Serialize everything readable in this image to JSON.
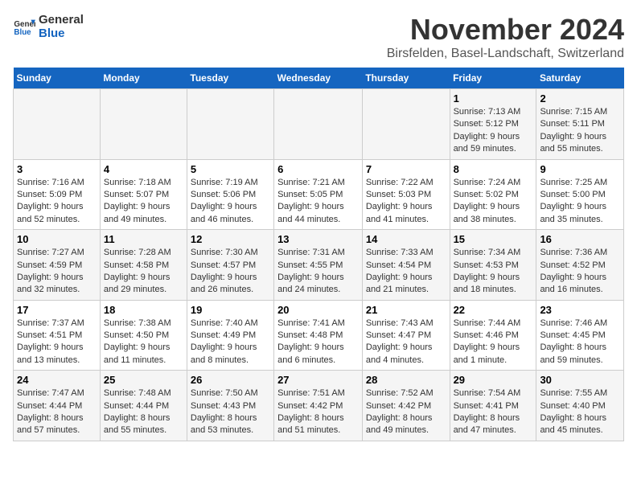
{
  "logo": {
    "line1": "General",
    "line2": "Blue"
  },
  "title": "November 2024",
  "location": "Birsfelden, Basel-Landschaft, Switzerland",
  "days_of_week": [
    "Sunday",
    "Monday",
    "Tuesday",
    "Wednesday",
    "Thursday",
    "Friday",
    "Saturday"
  ],
  "weeks": [
    [
      {
        "day": "",
        "info": ""
      },
      {
        "day": "",
        "info": ""
      },
      {
        "day": "",
        "info": ""
      },
      {
        "day": "",
        "info": ""
      },
      {
        "day": "",
        "info": ""
      },
      {
        "day": "1",
        "info": "Sunrise: 7:13 AM\nSunset: 5:12 PM\nDaylight: 9 hours and 59 minutes."
      },
      {
        "day": "2",
        "info": "Sunrise: 7:15 AM\nSunset: 5:11 PM\nDaylight: 9 hours and 55 minutes."
      }
    ],
    [
      {
        "day": "3",
        "info": "Sunrise: 7:16 AM\nSunset: 5:09 PM\nDaylight: 9 hours and 52 minutes."
      },
      {
        "day": "4",
        "info": "Sunrise: 7:18 AM\nSunset: 5:07 PM\nDaylight: 9 hours and 49 minutes."
      },
      {
        "day": "5",
        "info": "Sunrise: 7:19 AM\nSunset: 5:06 PM\nDaylight: 9 hours and 46 minutes."
      },
      {
        "day": "6",
        "info": "Sunrise: 7:21 AM\nSunset: 5:05 PM\nDaylight: 9 hours and 44 minutes."
      },
      {
        "day": "7",
        "info": "Sunrise: 7:22 AM\nSunset: 5:03 PM\nDaylight: 9 hours and 41 minutes."
      },
      {
        "day": "8",
        "info": "Sunrise: 7:24 AM\nSunset: 5:02 PM\nDaylight: 9 hours and 38 minutes."
      },
      {
        "day": "9",
        "info": "Sunrise: 7:25 AM\nSunset: 5:00 PM\nDaylight: 9 hours and 35 minutes."
      }
    ],
    [
      {
        "day": "10",
        "info": "Sunrise: 7:27 AM\nSunset: 4:59 PM\nDaylight: 9 hours and 32 minutes."
      },
      {
        "day": "11",
        "info": "Sunrise: 7:28 AM\nSunset: 4:58 PM\nDaylight: 9 hours and 29 minutes."
      },
      {
        "day": "12",
        "info": "Sunrise: 7:30 AM\nSunset: 4:57 PM\nDaylight: 9 hours and 26 minutes."
      },
      {
        "day": "13",
        "info": "Sunrise: 7:31 AM\nSunset: 4:55 PM\nDaylight: 9 hours and 24 minutes."
      },
      {
        "day": "14",
        "info": "Sunrise: 7:33 AM\nSunset: 4:54 PM\nDaylight: 9 hours and 21 minutes."
      },
      {
        "day": "15",
        "info": "Sunrise: 7:34 AM\nSunset: 4:53 PM\nDaylight: 9 hours and 18 minutes."
      },
      {
        "day": "16",
        "info": "Sunrise: 7:36 AM\nSunset: 4:52 PM\nDaylight: 9 hours and 16 minutes."
      }
    ],
    [
      {
        "day": "17",
        "info": "Sunrise: 7:37 AM\nSunset: 4:51 PM\nDaylight: 9 hours and 13 minutes."
      },
      {
        "day": "18",
        "info": "Sunrise: 7:38 AM\nSunset: 4:50 PM\nDaylight: 9 hours and 11 minutes."
      },
      {
        "day": "19",
        "info": "Sunrise: 7:40 AM\nSunset: 4:49 PM\nDaylight: 9 hours and 8 minutes."
      },
      {
        "day": "20",
        "info": "Sunrise: 7:41 AM\nSunset: 4:48 PM\nDaylight: 9 hours and 6 minutes."
      },
      {
        "day": "21",
        "info": "Sunrise: 7:43 AM\nSunset: 4:47 PM\nDaylight: 9 hours and 4 minutes."
      },
      {
        "day": "22",
        "info": "Sunrise: 7:44 AM\nSunset: 4:46 PM\nDaylight: 9 hours and 1 minute."
      },
      {
        "day": "23",
        "info": "Sunrise: 7:46 AM\nSunset: 4:45 PM\nDaylight: 8 hours and 59 minutes."
      }
    ],
    [
      {
        "day": "24",
        "info": "Sunrise: 7:47 AM\nSunset: 4:44 PM\nDaylight: 8 hours and 57 minutes."
      },
      {
        "day": "25",
        "info": "Sunrise: 7:48 AM\nSunset: 4:44 PM\nDaylight: 8 hours and 55 minutes."
      },
      {
        "day": "26",
        "info": "Sunrise: 7:50 AM\nSunset: 4:43 PM\nDaylight: 8 hours and 53 minutes."
      },
      {
        "day": "27",
        "info": "Sunrise: 7:51 AM\nSunset: 4:42 PM\nDaylight: 8 hours and 51 minutes."
      },
      {
        "day": "28",
        "info": "Sunrise: 7:52 AM\nSunset: 4:42 PM\nDaylight: 8 hours and 49 minutes."
      },
      {
        "day": "29",
        "info": "Sunrise: 7:54 AM\nSunset: 4:41 PM\nDaylight: 8 hours and 47 minutes."
      },
      {
        "day": "30",
        "info": "Sunrise: 7:55 AM\nSunset: 4:40 PM\nDaylight: 8 hours and 45 minutes."
      }
    ]
  ]
}
